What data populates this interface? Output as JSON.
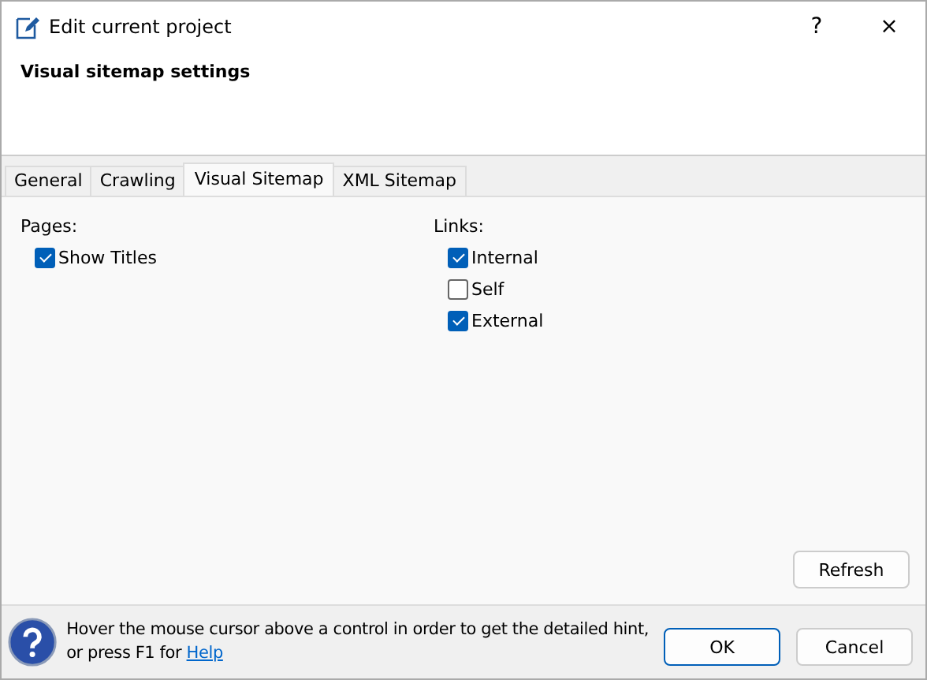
{
  "window": {
    "title": "Edit current project",
    "help_glyph": "?",
    "close_glyph": "×"
  },
  "header": {
    "title": "Visual sitemap settings"
  },
  "tabs": [
    {
      "label": "General",
      "selected": false
    },
    {
      "label": "Crawling",
      "selected": false
    },
    {
      "label": "Visual Sitemap",
      "selected": true
    },
    {
      "label": "XML Sitemap",
      "selected": false
    }
  ],
  "groups": [
    {
      "label": "Pages:",
      "options": [
        {
          "label": "Show Titles",
          "checked": true
        }
      ]
    },
    {
      "label": "Links:",
      "options": [
        {
          "label": "Internal",
          "checked": true
        },
        {
          "label": "Self",
          "checked": false
        },
        {
          "label": "External",
          "checked": true
        }
      ]
    }
  ],
  "refresh_button": "Refresh",
  "hint": {
    "text": "Hover the mouse cursor above a control in order to get the detailed hint, or press F1 for ",
    "link": "Help"
  },
  "buttons": [
    {
      "label": "OK",
      "default": true
    },
    {
      "label": "Cancel",
      "default": false
    }
  ]
}
